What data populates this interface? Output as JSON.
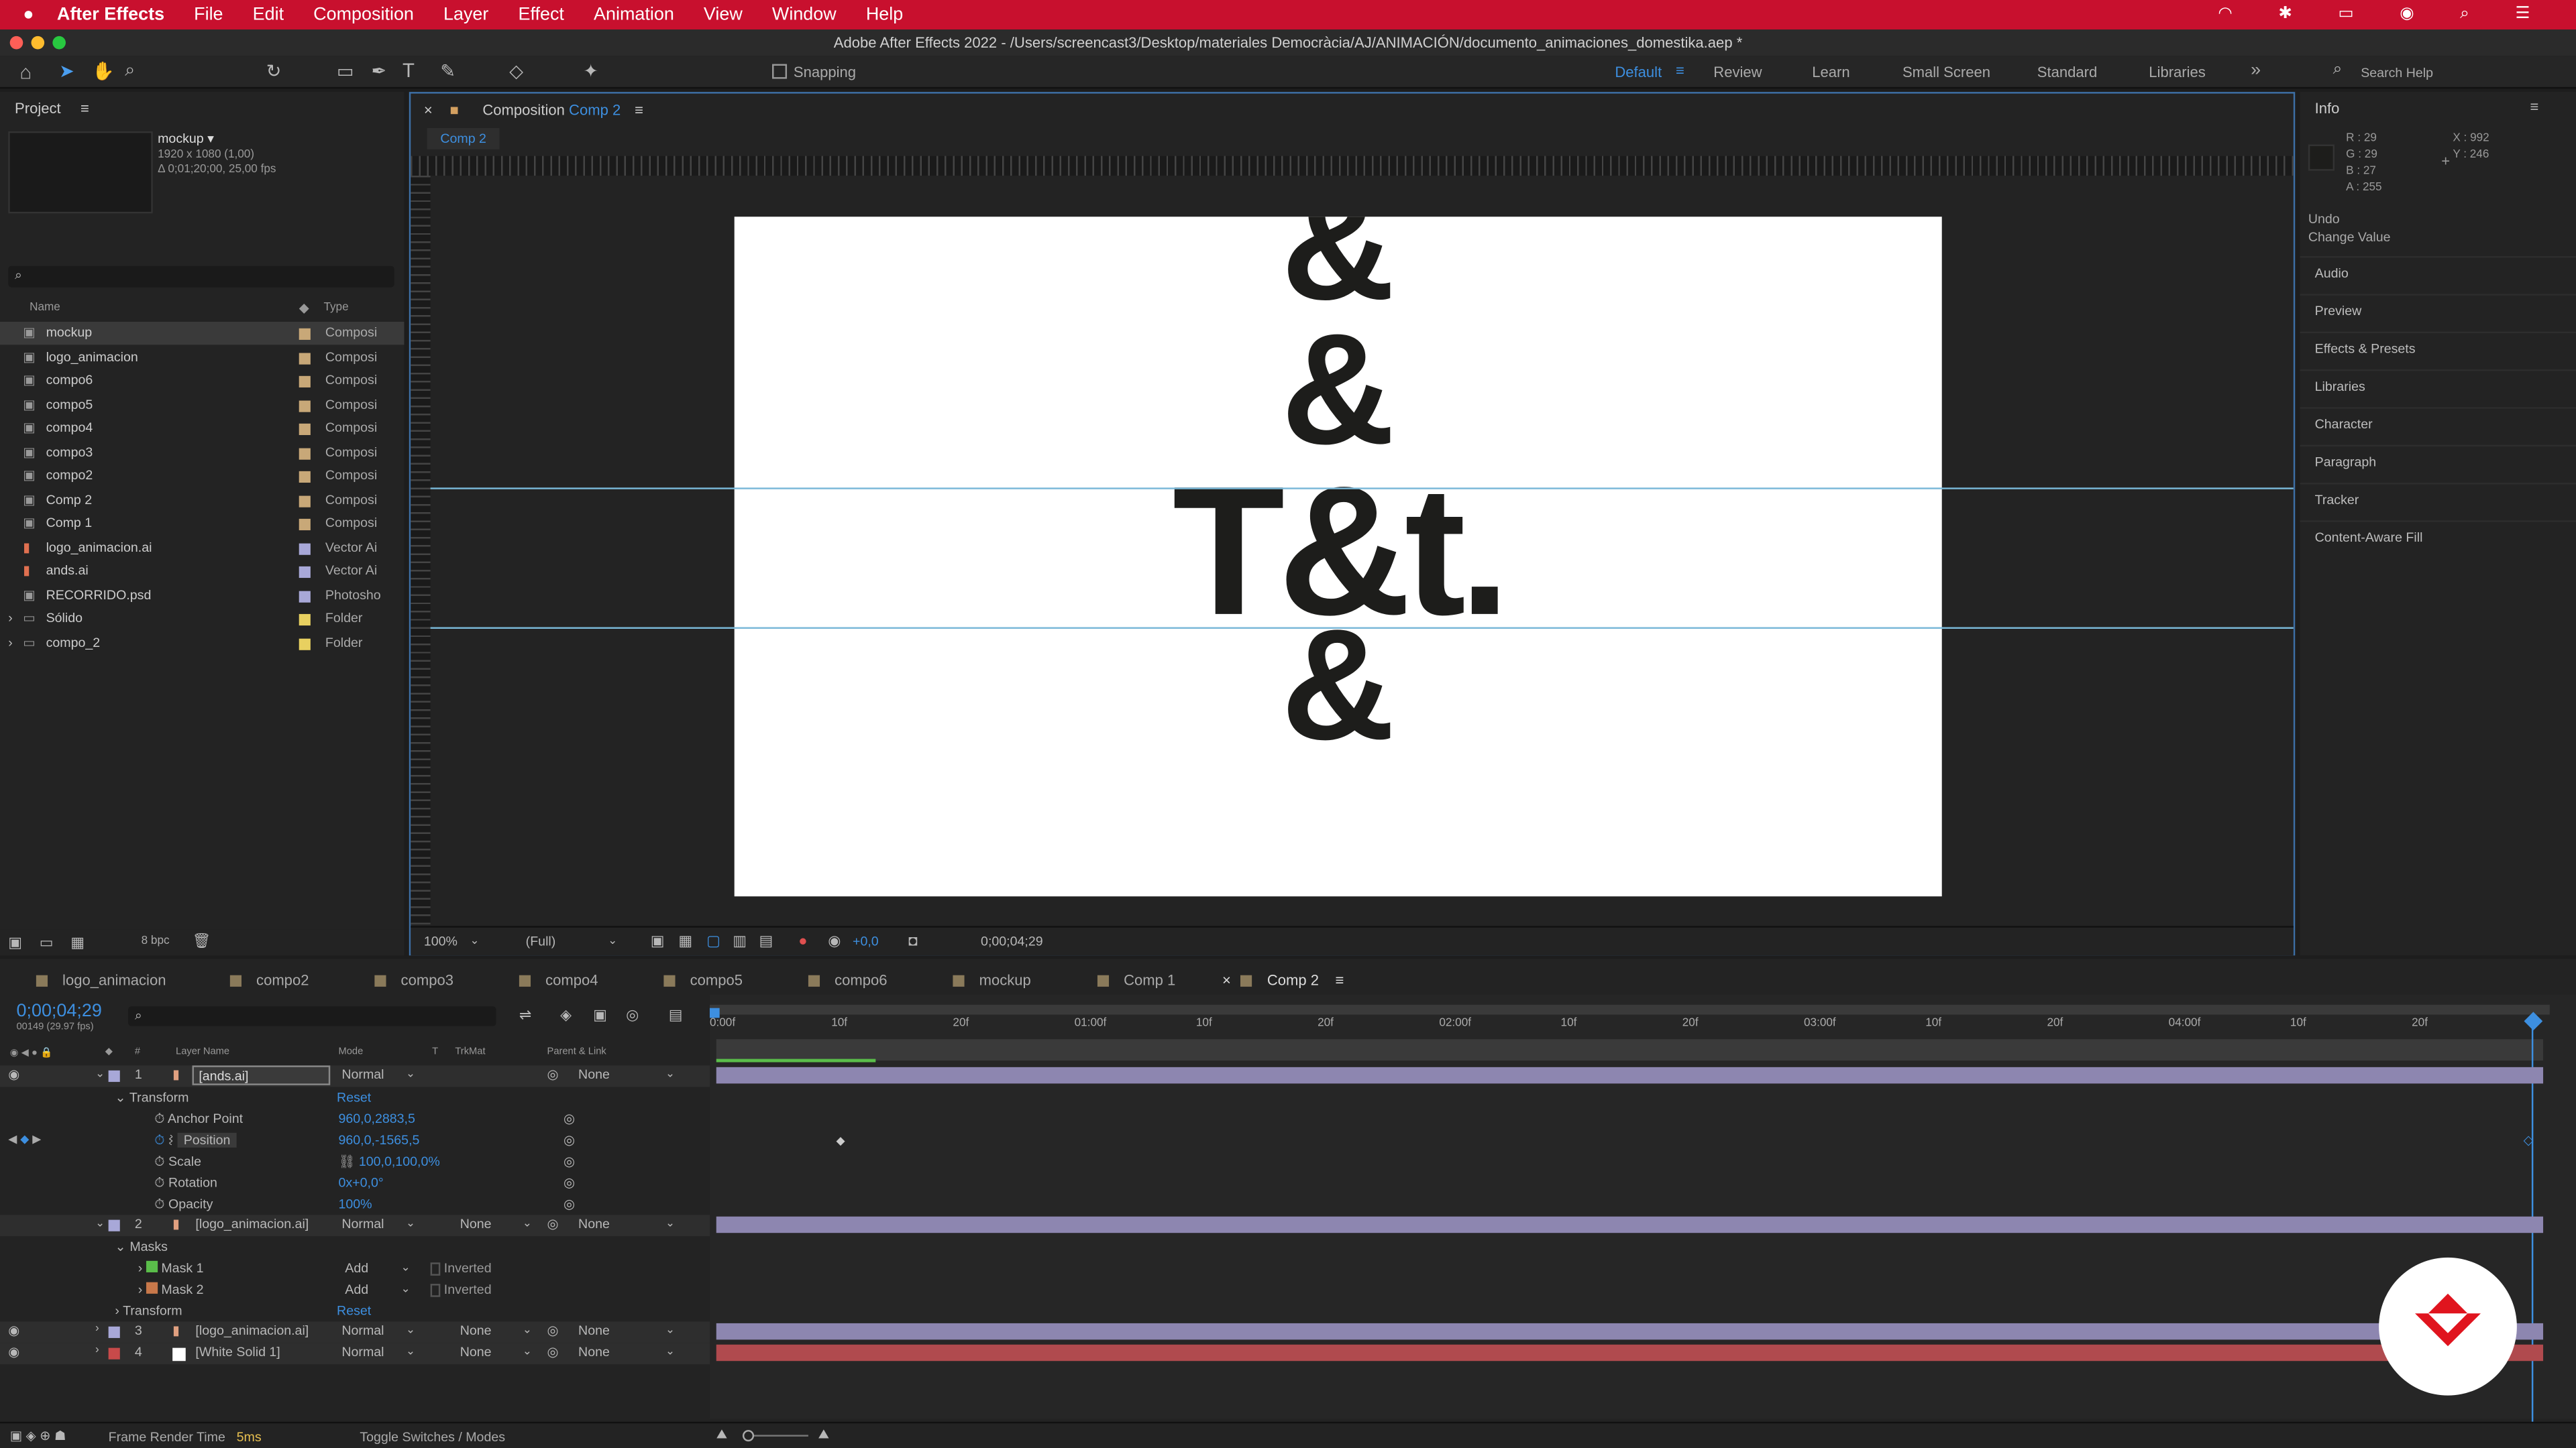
{
  "menubar": {
    "apple": "",
    "app": "After Effects",
    "items": [
      "File",
      "Edit",
      "Composition",
      "Layer",
      "Effect",
      "Animation",
      "View",
      "Window",
      "Help"
    ]
  },
  "titlebar": "Adobe After Effects 2022 - /Users/screencast3/Desktop/materiales Democràcia/AJ/ANIMACIÓN/documento_animaciones_domestika.aep *",
  "toolbar": {
    "snapping": "Snapping",
    "workspaces": [
      "Default",
      "Review",
      "Learn",
      "Small Screen",
      "Standard",
      "Libraries"
    ],
    "search_placeholder": "Search Help"
  },
  "project": {
    "title": "Project",
    "selected_name": "mockup ▾",
    "selected_info1": "1920 x 1080 (1,00)",
    "selected_info2": "Δ 0;01;20;00, 25,00 fps",
    "col_name": "Name",
    "col_type": "Type",
    "items": [
      {
        "name": "mockup",
        "type": "Composi",
        "color": "#c8a878"
      },
      {
        "name": "logo_animacion",
        "type": "Composi",
        "color": "#c8a878"
      },
      {
        "name": "compo6",
        "type": "Composi",
        "color": "#c8a878"
      },
      {
        "name": "compo5",
        "type": "Composi",
        "color": "#c8a878"
      },
      {
        "name": "compo4",
        "type": "Composi",
        "color": "#c8a878"
      },
      {
        "name": "compo3",
        "type": "Composi",
        "color": "#c8a878"
      },
      {
        "name": "compo2",
        "type": "Composi",
        "color": "#c8a878"
      },
      {
        "name": "Comp 2",
        "type": "Composi",
        "color": "#c8a878"
      },
      {
        "name": "Comp 1",
        "type": "Composi",
        "color": "#c8a878"
      },
      {
        "name": "logo_animacion.ai",
        "type": "Vector Ai",
        "color": "#a8a8d8"
      },
      {
        "name": "ands.ai",
        "type": "Vector Ai",
        "color": "#a8a8d8"
      },
      {
        "name": "RECORRIDO.psd",
        "type": "Photosho",
        "color": "#a8a8d8"
      },
      {
        "name": "Sólido",
        "type": "Folder",
        "color": "#e8d060"
      },
      {
        "name": "compo_2",
        "type": "Folder",
        "color": "#e8d060"
      }
    ],
    "bpc": "8 bpc"
  },
  "comp": {
    "panel_label": "Composition",
    "comp_name": "Comp 2",
    "flow_tab": "Comp 2",
    "amp1": "&",
    "amp2": "&",
    "main": "T&t.",
    "amp3": "&",
    "zoom": "100%",
    "resolution": "(Full)",
    "exposure": "+0,0",
    "timecode": "0;00;04;29"
  },
  "info": {
    "title": "Info",
    "r": "R : 29",
    "g": "G : 29",
    "b": "B : 27",
    "a": "A : 255",
    "x": "X : 992",
    "y": "Y : 246",
    "undo": "Undo",
    "undo_action": "Change Value",
    "panels": [
      "Audio",
      "Preview",
      "Effects & Presets",
      "Libraries",
      "Character",
      "Paragraph",
      "Tracker",
      "Content-Aware Fill"
    ]
  },
  "timeline": {
    "tabs": [
      "logo_animacion",
      "compo2",
      "compo3",
      "compo4",
      "compo5",
      "compo6",
      "mockup",
      "Comp 1",
      "Comp 2"
    ],
    "timecode": "0;00;04;29",
    "frames": "00149 (29.97 fps)",
    "headers": {
      "layer_name": "Layer Name",
      "mode": "Mode",
      "t": "T",
      "trkmat": "TrkMat",
      "parent": "Parent & Link"
    },
    "ruler": [
      "0:00f",
      "10f",
      "20f",
      "01:00f",
      "10f",
      "20f",
      "02:00f",
      "10f",
      "20f",
      "03:00f",
      "10f",
      "20f",
      "04:00f",
      "10f",
      "20f"
    ],
    "layer1": {
      "num": "1",
      "name": "[ands.ai]",
      "mode": "Normal",
      "parent": "None"
    },
    "transform": "Transform",
    "reset": "Reset",
    "props": [
      {
        "name": "Anchor Point",
        "value": "960,0,2883,5"
      },
      {
        "name": "Position",
        "value": "960,0,-1565,5"
      },
      {
        "name": "Scale",
        "value": "100,0,100,0%"
      },
      {
        "name": "Rotation",
        "value": "0x+0,0°"
      },
      {
        "name": "Opacity",
        "value": "100%"
      }
    ],
    "layer2": {
      "num": "2",
      "name": "[logo_animacion.ai]",
      "mode": "Normal",
      "trkmat": "None",
      "parent": "None"
    },
    "masks": "Masks",
    "mask1": {
      "name": "Mask 1",
      "mode": "Add",
      "inverted": "Inverted"
    },
    "mask2": {
      "name": "Mask 2",
      "mode": "Add",
      "inverted": "Inverted"
    },
    "layer3": {
      "num": "3",
      "name": "[logo_animacion.ai]",
      "mode": "Normal",
      "trkmat": "None",
      "parent": "None"
    },
    "layer4": {
      "num": "4",
      "name": "[White Solid 1]",
      "mode": "Normal",
      "trkmat": "None",
      "parent": "None"
    },
    "footer": {
      "render_label": "Frame Render Time",
      "render_value": "5ms",
      "toggle": "Toggle Switches / Modes"
    }
  },
  "colors": {
    "accent": "#3d8fe0",
    "menubar": "#c8102e",
    "layer_bar": "#8d86b0",
    "solid_bar": "#b04a4e",
    "logo": "#e0141e"
  }
}
